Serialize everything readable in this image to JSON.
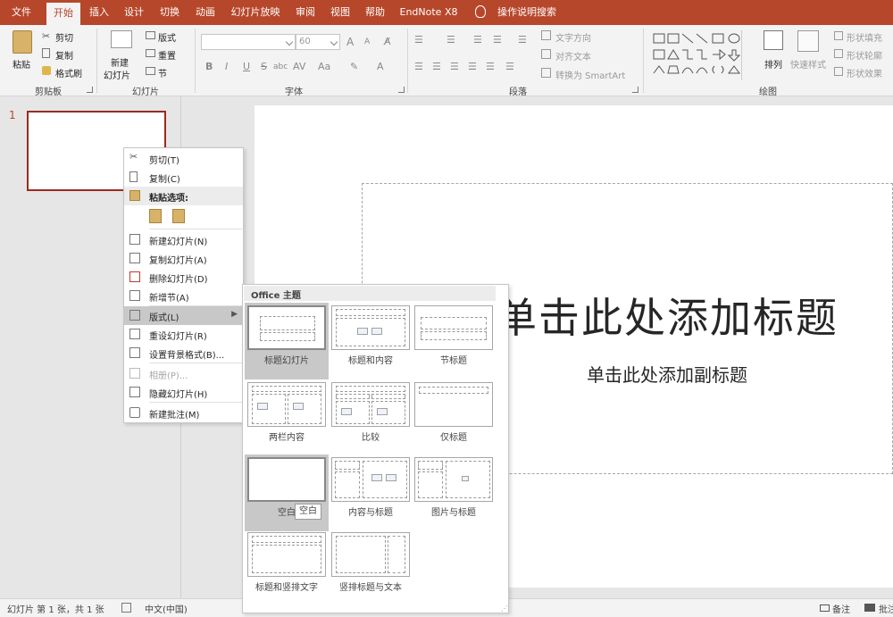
{
  "tabs": [
    "文件",
    "开始",
    "插入",
    "设计",
    "切换",
    "动画",
    "幻灯片放映",
    "审阅",
    "视图",
    "帮助",
    "EndNote X8"
  ],
  "active_tab_index": 1,
  "tell_me": "操作说明搜索",
  "clipboard": {
    "paste": "粘贴",
    "cut": "剪切",
    "copy": "复制",
    "painter": "格式刷",
    "label": "剪贴板"
  },
  "slides": {
    "new_slide": "新建",
    "new_slide2": "幻灯片",
    "layout": "版式",
    "reset": "重置",
    "section": "节",
    "label": "幻灯片"
  },
  "font": {
    "size": "60",
    "label": "字体",
    "bold": "B",
    "italic": "I",
    "underline": "U",
    "strike": "S",
    "shadow": "abc",
    "grow": "A",
    "shrink": "A"
  },
  "paragraph": {
    "text_direction": "文字方向",
    "align_text": "对齐文本",
    "smartart": "转换为 SmartArt",
    "label": "段落"
  },
  "drawing": {
    "arrange": "排列",
    "quick_styles": "快速样式",
    "fill": "形状填充",
    "outline": "形状轮廓",
    "effects": "形状效果",
    "label": "绘图"
  },
  "slide_number": "1",
  "slide": {
    "title": "单击此处添加标题",
    "subtitle": "单击此处添加副标题"
  },
  "context_menu": [
    {
      "label": "剪切(T)",
      "icon": "scissors-icon",
      "state": "normal"
    },
    {
      "label": "复制(C)",
      "icon": "copy-icon",
      "state": "normal"
    },
    {
      "label": "粘贴选项:",
      "icon": "paste-icon",
      "state": "header"
    },
    {
      "label": "新建幻灯片(N)",
      "icon": "new-slide-icon",
      "state": "normal"
    },
    {
      "label": "复制幻灯片(A)",
      "icon": "duplicate-slide-icon",
      "state": "normal"
    },
    {
      "label": "删除幻灯片(D)",
      "icon": "delete-slide-icon",
      "state": "normal"
    },
    {
      "label": "新增节(A)",
      "icon": "section-icon",
      "state": "normal"
    },
    {
      "label": "版式(L)",
      "icon": "layout-icon",
      "state": "highlight"
    },
    {
      "label": "重设幻灯片(R)",
      "icon": "reset-icon",
      "state": "normal"
    },
    {
      "label": "设置背景格式(B)...",
      "icon": "background-icon",
      "state": "normal"
    },
    {
      "label": "相册(P)...",
      "icon": "album-icon",
      "state": "disabled"
    },
    {
      "label": "隐藏幻灯片(H)",
      "icon": "hide-slide-icon",
      "state": "normal"
    },
    {
      "label": "新建批注(M)",
      "icon": "comment-icon",
      "state": "normal"
    }
  ],
  "gallery": {
    "header": "Office 主题",
    "layouts": [
      "标题幻灯片",
      "标题和内容",
      "节标题",
      "两栏内容",
      "比较",
      "仅标题",
      "空白",
      "内容与标题",
      "图片与标题",
      "标题和竖排文字",
      "竖排标题与文本"
    ],
    "tooltip": "空白"
  },
  "status": {
    "slide_info": "幻灯片 第 1 张，共 1 张",
    "language": "中文(中国)",
    "notes": "备注",
    "comments": "批注"
  },
  "colors": {
    "accent": "#b7472a",
    "thumb_border": "#9a2b1d"
  }
}
